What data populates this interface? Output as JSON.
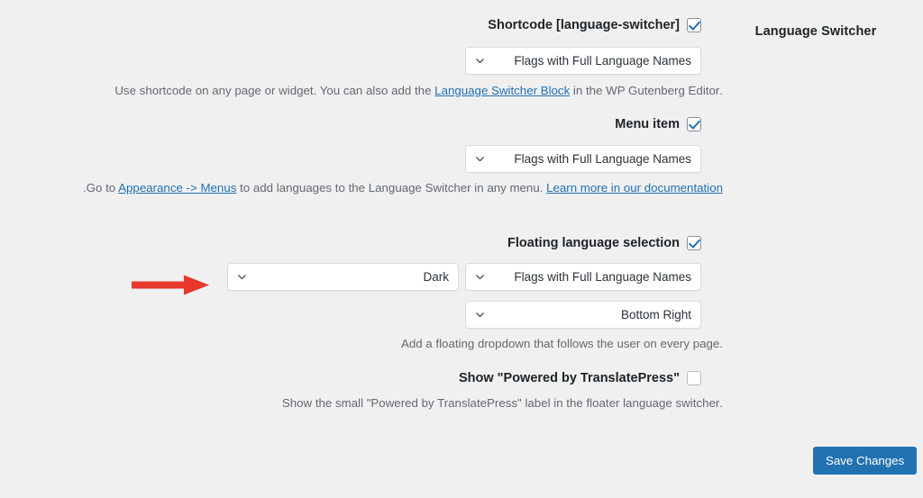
{
  "panel": {
    "title": "Language Switcher"
  },
  "sections": {
    "shortcode": {
      "label": "Shortcode [language-switcher]",
      "checkbox_state": "checked",
      "select_value": "Flags with Full Language Names",
      "description_prefix": ".Use shortcode on any page or widget. You can also add the ",
      "description_link": "Language Switcher Block",
      "description_suffix": " in the WP Gutenberg Editor"
    },
    "menu_item": {
      "label": "Menu item",
      "checkbox_state": "checked",
      "select_value": "Flags with Full Language Names",
      "description_part1": "Go to ",
      "description_link1": "Appearance -> Menus",
      "description_part2": " to add languages to the Language Switcher in any menu. ",
      "description_link2": "Learn more in our documentation",
      "description_part3": "."
    },
    "floating": {
      "label": "Floating language selection",
      "checkbox_state": "checked",
      "select_style_value": "Dark",
      "select_type_value": "Flags with Full Language Names",
      "select_position_value": "Bottom Right",
      "description": ".Add a floating dropdown that follows the user on every page"
    },
    "powered_by": {
      "label": "\"Show \"Powered by TranslatePress",
      "checkbox_state": "unchecked",
      "description": ".Show the small \"Powered by TranslatePress\" label in the floater language switcher"
    }
  },
  "footer": {
    "save_label": "Save Changes"
  },
  "annotation": {
    "arrow_color": "#e8382c",
    "arrow_direction": "right",
    "points_at": "Dark"
  },
  "colors": {
    "background": "#f0f0f1",
    "accent": "#2271b1",
    "text": "#3c434a",
    "heading": "#1d2327",
    "muted": "#646970",
    "field_border": "#dcdcde"
  }
}
